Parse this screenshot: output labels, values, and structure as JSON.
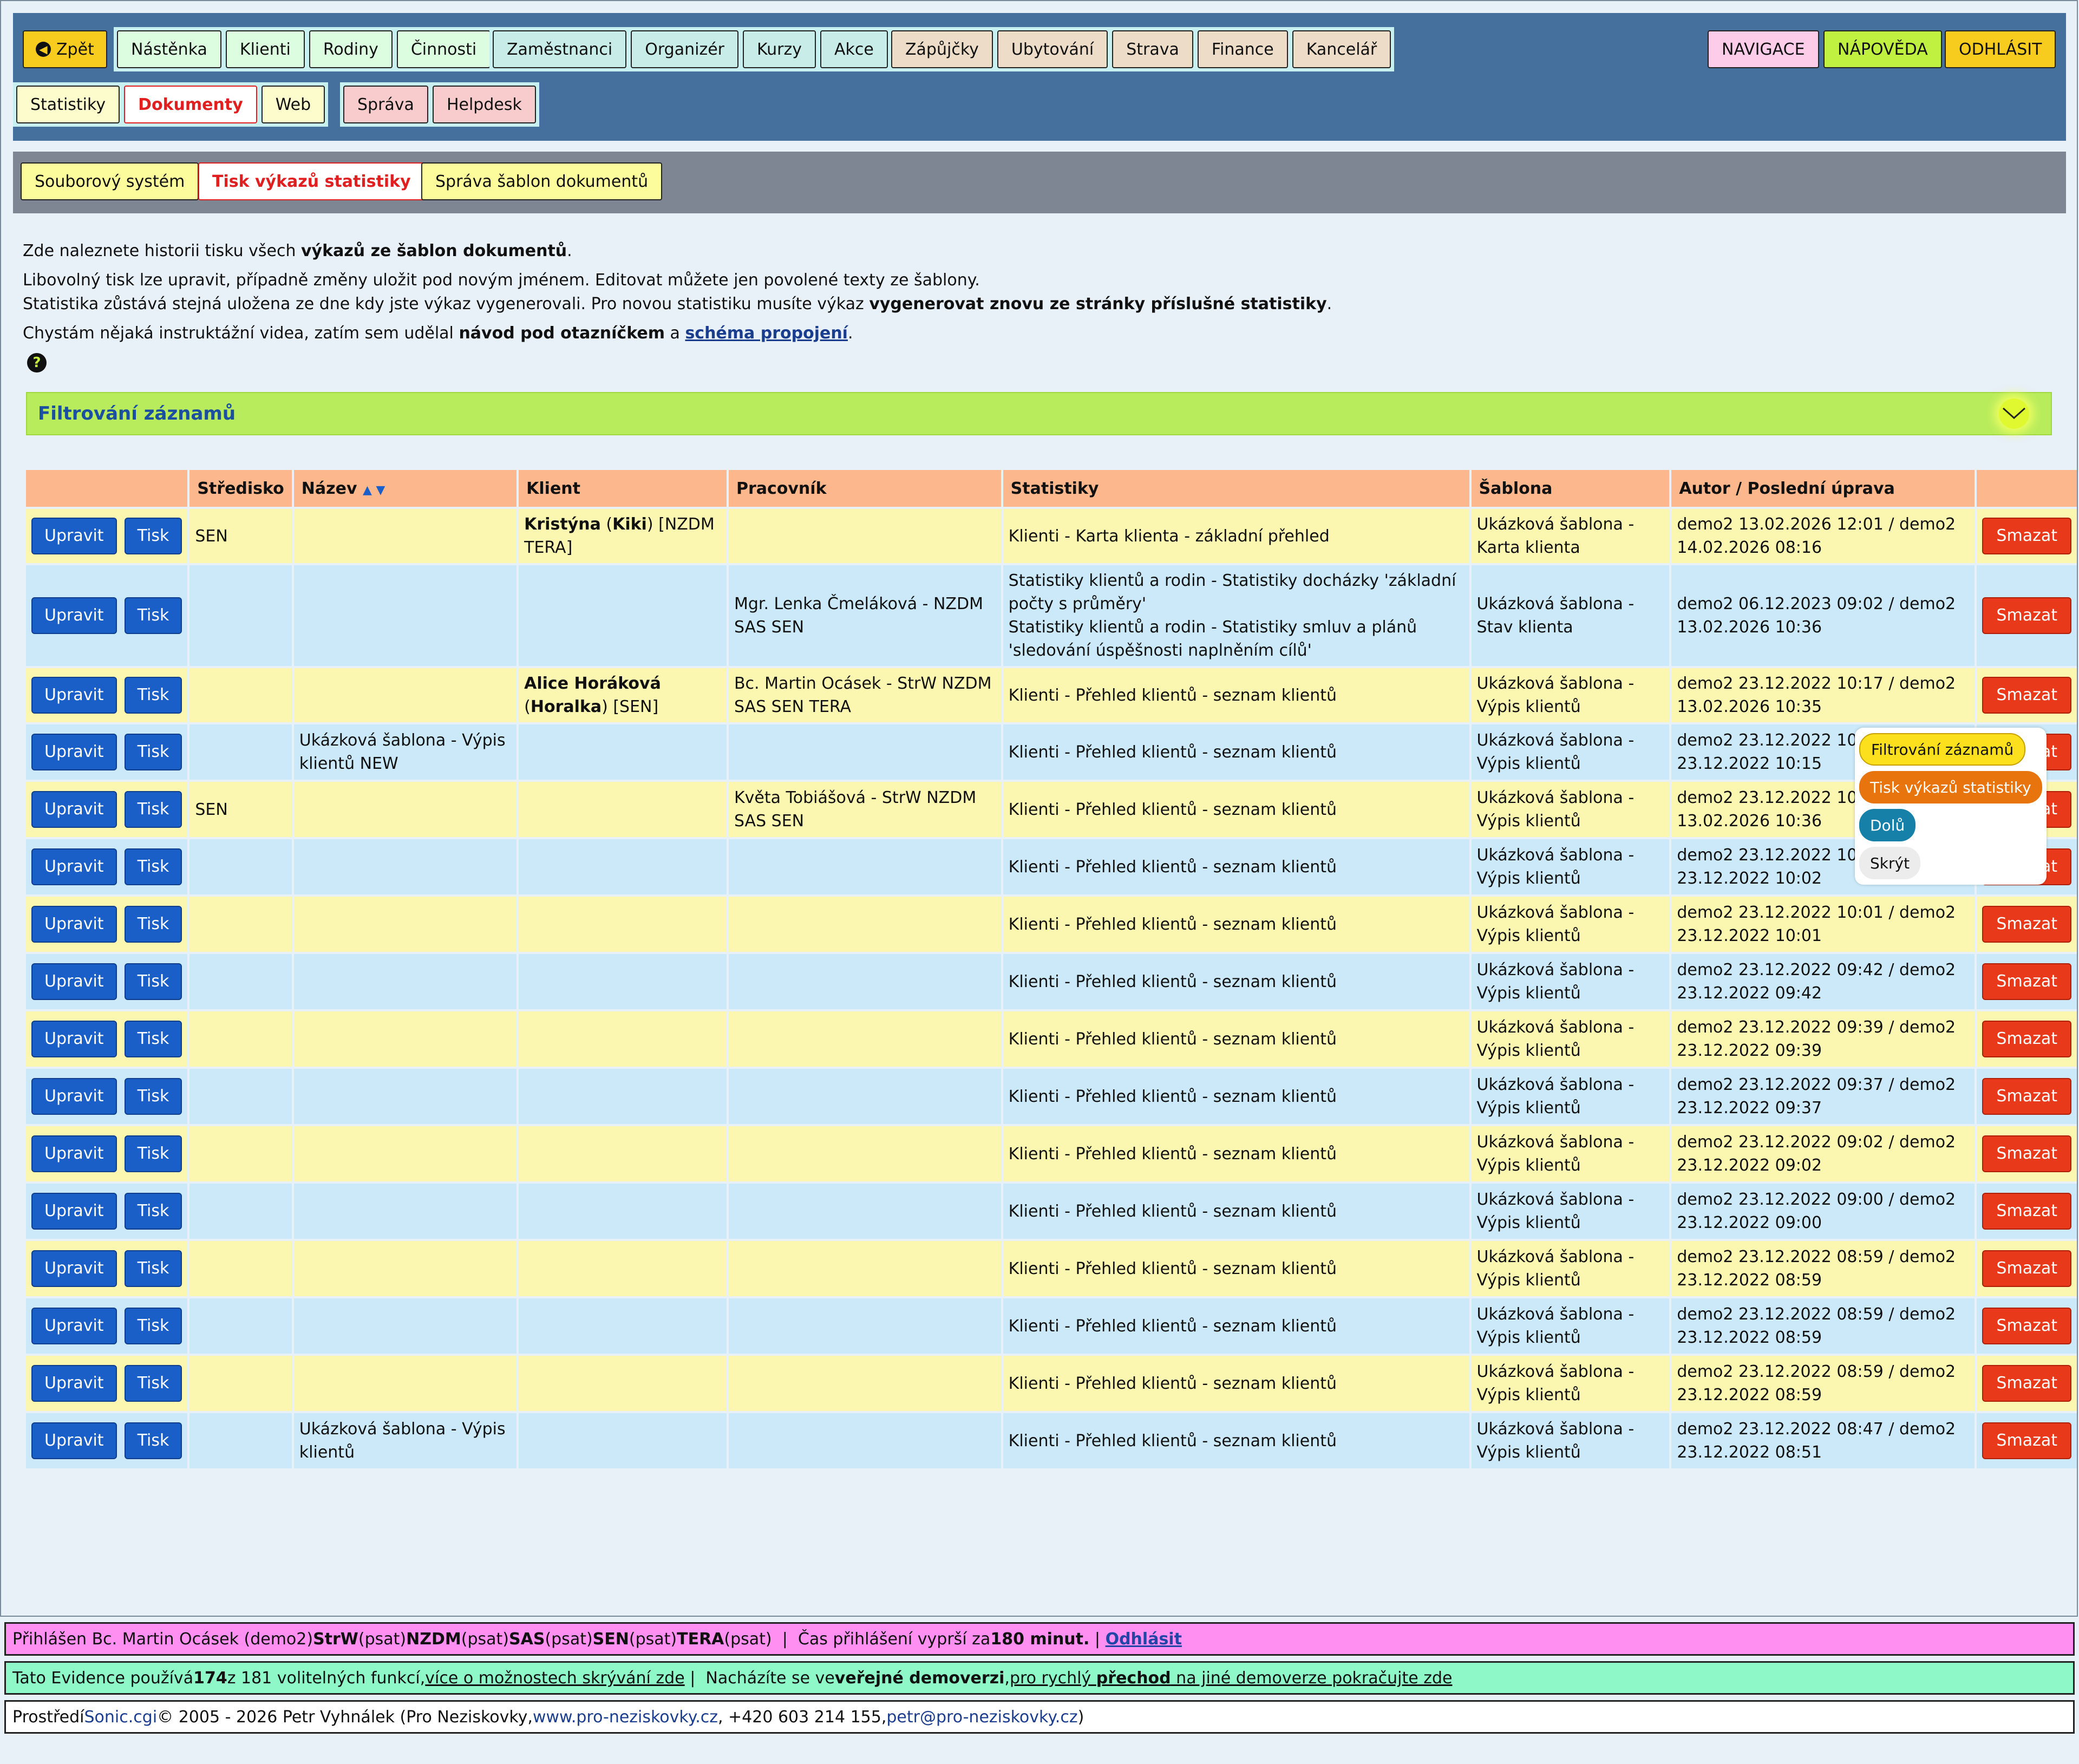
{
  "nav": {
    "back": "Zpět",
    "group1": [
      "Nástěnka",
      "Klienti",
      "Rodiny",
      "Činnosti"
    ],
    "group2": [
      "Zaměstnanci",
      "Organizér",
      "Kurzy",
      "Akce"
    ],
    "group3": [
      "Zápůjčky",
      "Ubytování",
      "Strava",
      "Finance",
      "Kancelář"
    ],
    "group4": [
      "Statistiky",
      "Dokumenty",
      "Web"
    ],
    "group5": [
      "Správa",
      "Helpdesk"
    ],
    "navigace": "NAVIGACE",
    "napoveda": "NÁPOVĚDA",
    "odhlasit": "ODHLÁSIT"
  },
  "subnav": [
    "Souborový systém",
    "Tisk výkazů statistiky",
    "Správa šablon dokumentů"
  ],
  "intro": {
    "l1a": "Zde naleznete historii tisku všech ",
    "l1b": "výkazů ze šablon dokumentů",
    "l1c": ".",
    "l2": "Libovolný tisk lze upravit, případně změny uložit pod novým jménem. Editovat můžete jen povolené texty ze šablony.",
    "l3a": "Statistika zůstává stejná uložena ze dne kdy jste výkaz vygenerovali. Pro novou statistiku musíte výkaz ",
    "l3b": "vygenerovat znovu ze stránky příslušné statistiky",
    "l3c": ".",
    "l4a": "Chystám nějaká instruktážní videa, zatím sem udělal ",
    "l4b": "návod pod otazníčkem",
    "l4c": " a ",
    "l4d": "schéma propojení",
    "l4e": "."
  },
  "filter": {
    "title": "Filtrování záznamů"
  },
  "table": {
    "headers": [
      "",
      "Středisko",
      "Název",
      "Klient",
      "Pracovník",
      "Statistiky",
      "Šablona",
      "Autor / Poslední úprava",
      ""
    ],
    "btn_edit": "Upravit",
    "btn_print": "Tisk",
    "btn_delete": "Smazat",
    "rows": [
      {
        "s": "SEN",
        "n": "",
        "k": "<b>Kristýna</b> (<b>Kiki</b>) [NZDM TERA]",
        "p": "",
        "st": "Klienti - Karta klienta - základní přehled",
        "sab": "Ukázková šablona - Karta klienta",
        "a": "demo2 13.02.2026 12:01 / demo2 14.02.2026 08:16"
      },
      {
        "s": "",
        "n": "",
        "k": "",
        "p": "Mgr. Lenka Čmeláková - NZDM SAS SEN",
        "st": "Statistiky klientů a rodin - Statistiky docházky 'základní počty s průměry'<br>Statistiky klientů a rodin - Statistiky smluv a plánů 'sledování úspěšnosti naplněním cílů'",
        "sab": "Ukázková šablona - Stav klienta",
        "a": "demo2 06.12.2023 09:02 / demo2 13.02.2026 10:36"
      },
      {
        "s": "",
        "n": "",
        "k": "<b>Alice Horáková</b> (<b>Horalka</b>) [SEN]",
        "p": "Bc. Martin Ocásek - StrW NZDM SAS SEN TERA",
        "st": "Klienti - Přehled klientů - seznam klientů",
        "sab": "Ukázková šablona - Výpis klientů",
        "a": "demo2 23.12.2022 10:17 / demo2 13.02.2026 10:35"
      },
      {
        "s": "",
        "n": "Ukázková šablona - Výpis klientů NEW",
        "k": "",
        "p": "",
        "st": "Klienti - Přehled klientů - seznam klientů",
        "sab": "Ukázková šablona - Výpis klientů",
        "a": "demo2 23.12.2022 10:0<br>23.12.2022 10:15"
      },
      {
        "s": "SEN",
        "n": "",
        "k": "",
        "p": "Květa Tobiášová - StrW NZDM SAS SEN",
        "st": "Klienti - Přehled klientů - seznam klientů",
        "sab": "Ukázková šablona - Výpis klientů",
        "a": "demo2 23.12.2022 10:0<br>13.02.2026 10:36"
      },
      {
        "s": "",
        "n": "",
        "k": "",
        "p": "",
        "st": "Klienti - Přehled klientů - seznam klientů",
        "sab": "Ukázková šablona - Výpis klientů",
        "a": "demo2 23.12.2022 10:0<br>23.12.2022 10:02"
      },
      {
        "s": "",
        "n": "",
        "k": "",
        "p": "",
        "st": "Klienti - Přehled klientů - seznam klientů",
        "sab": "Ukázková šablona - Výpis klientů",
        "a": "demo2 23.12.2022 10:01 / demo2 23.12.2022 10:01"
      },
      {
        "s": "",
        "n": "",
        "k": "",
        "p": "",
        "st": "Klienti - Přehled klientů - seznam klientů",
        "sab": "Ukázková šablona - Výpis klientů",
        "a": "demo2 23.12.2022 09:42 / demo2 23.12.2022 09:42"
      },
      {
        "s": "",
        "n": "",
        "k": "",
        "p": "",
        "st": "Klienti - Přehled klientů - seznam klientů",
        "sab": "Ukázková šablona - Výpis klientů",
        "a": "demo2 23.12.2022 09:39 / demo2 23.12.2022 09:39"
      },
      {
        "s": "",
        "n": "",
        "k": "",
        "p": "",
        "st": "Klienti - Přehled klientů - seznam klientů",
        "sab": "Ukázková šablona - Výpis klientů",
        "a": "demo2 23.12.2022 09:37 / demo2 23.12.2022 09:37"
      },
      {
        "s": "",
        "n": "",
        "k": "",
        "p": "",
        "st": "Klienti - Přehled klientů - seznam klientů",
        "sab": "Ukázková šablona - Výpis klientů",
        "a": "demo2 23.12.2022 09:02 / demo2 23.12.2022 09:02"
      },
      {
        "s": "",
        "n": "",
        "k": "",
        "p": "",
        "st": "Klienti - Přehled klientů - seznam klientů",
        "sab": "Ukázková šablona - Výpis klientů",
        "a": "demo2 23.12.2022 09:00 / demo2 23.12.2022 09:00"
      },
      {
        "s": "",
        "n": "",
        "k": "",
        "p": "",
        "st": "Klienti - Přehled klientů - seznam klientů",
        "sab": "Ukázková šablona - Výpis klientů",
        "a": "demo2 23.12.2022 08:59 / demo2 23.12.2022 08:59"
      },
      {
        "s": "",
        "n": "",
        "k": "",
        "p": "",
        "st": "Klienti - Přehled klientů - seznam klientů",
        "sab": "Ukázková šablona - Výpis klientů",
        "a": "demo2 23.12.2022 08:59 / demo2 23.12.2022 08:59"
      },
      {
        "s": "",
        "n": "",
        "k": "",
        "p": "",
        "st": "Klienti - Přehled klientů - seznam klientů",
        "sab": "Ukázková šablona - Výpis klientů",
        "a": "demo2 23.12.2022 08:59 / demo2 23.12.2022 08:59"
      },
      {
        "s": "",
        "n": "Ukázková šablona - Výpis klientů",
        "k": "",
        "p": "",
        "st": "Klienti - Přehled klientů - seznam klientů",
        "sab": "Ukázková šablona - Výpis klientů",
        "a": "demo2 23.12.2022 08:47 / demo2 23.12.2022 08:51"
      }
    ]
  },
  "popup": [
    "Filtrování záznamů",
    "Tisk výkazů statistiky",
    "Dolů",
    "Skrýt"
  ],
  "footer": {
    "f1": "Přihlášen Bc. Martin Ocásek (demo2) <b>StrW</b> (psat) <b>NZDM</b> (psat) <b>SAS</b> (psat) <b>SEN</b> (psat) <b>TERA</b> (psat) &nbsp;|&nbsp; Čas přihlášení vyprší za <b>180 minut.</b> &nbsp;|&nbsp; <span class='lnk'>Odhlásit</span>",
    "f2": "Tato Evidence používá <b>174</b> z 181 volitelných funkcí, <u>více o možnostech skrývání zde</u> &nbsp;|&nbsp; Nacházíte se ve <b>veřejné demoverzi</b>, <u>pro rychlý <b>přechod</b> na jiné demoverze pokračujte zde</u>",
    "f3": "Prostředí <a>Sonic.cgi</a> © 2005 - 2026 Petr Vyhnálek (Pro Neziskovky, <a>www.pro-neziskovky.cz</a>, +420 603 214 155, <a>petr@pro-neziskovky.cz</a>)"
  }
}
